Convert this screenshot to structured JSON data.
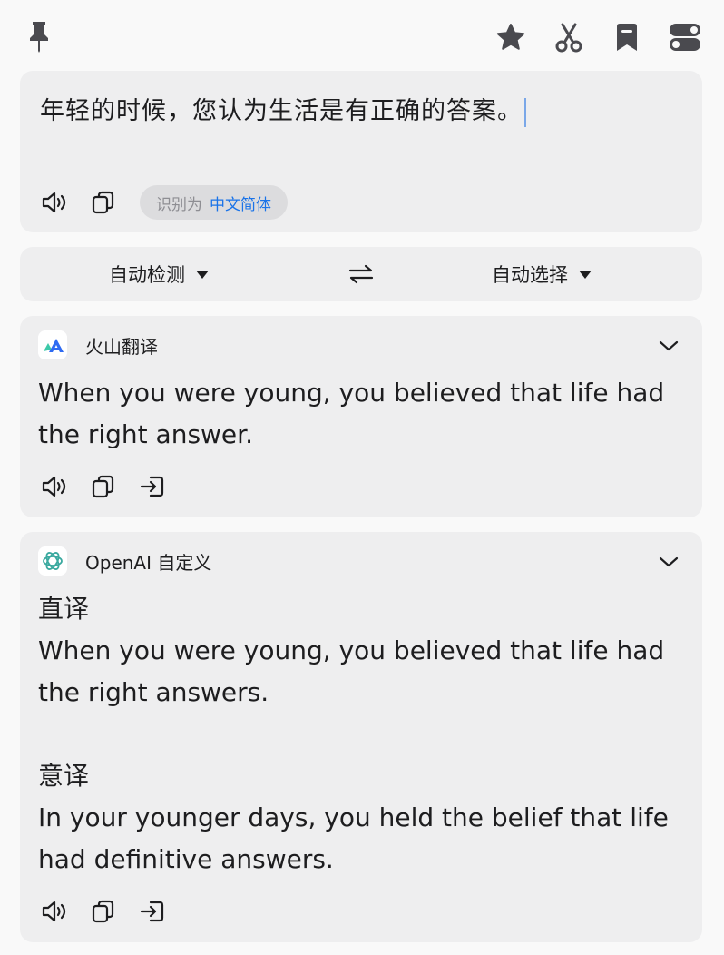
{
  "toolbar": {
    "left_icon": "pin-icon",
    "right_icons": [
      "star-icon",
      "scissors-icon",
      "bookmark-icon",
      "toggle-icon"
    ]
  },
  "source": {
    "text": "年轻的时候，您认为生活是有正确的答案。",
    "detected_label": "识别为",
    "detected_language": "中文简体"
  },
  "language_bar": {
    "from": "自动检测",
    "to": "自动选择"
  },
  "results": [
    {
      "service": "火山翻译",
      "text": "When you were young, you believed that life had the right answer."
    },
    {
      "service": "OpenAI 自定义",
      "text": "直译\nWhen you were young, you believed that life had the right answers.\n\n意译\nIn your younger days, you held the belief that life had definitive answers."
    }
  ],
  "colors": {
    "background": "#f9f9f9",
    "card": "#eeeeef",
    "accent": "#1a73e8",
    "icon": "#4a4a4f"
  }
}
